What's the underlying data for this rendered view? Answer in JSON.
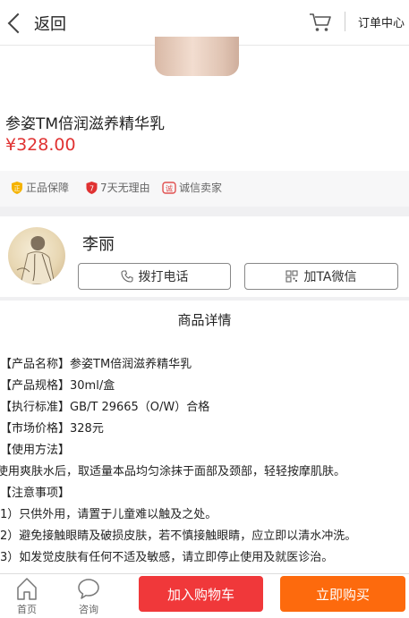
{
  "header": {
    "back_label": "返回",
    "orders_label": "订单中心"
  },
  "product": {
    "name": "参姿TM倍润滋养精华乳",
    "price": "¥328.00"
  },
  "badges": [
    {
      "icon": "shield-icon",
      "label": "正品保障",
      "color": "#f5b300"
    },
    {
      "icon": "seven-days-icon",
      "label": "7天无理由",
      "color": "#e03232"
    },
    {
      "icon": "credit-seal-icon",
      "label": "诚信卖家",
      "color": "#e05050"
    }
  ],
  "seller": {
    "name": "李丽",
    "call_label": "拨打电话",
    "wechat_label": "加TA微信"
  },
  "details": {
    "title": "商品详情",
    "lines": [
      "【产品名称】参姿TM倍润滋养精华乳",
      "【产品规格】30ml/盒",
      "【执行标准】GB/T 29665（O/W）合格",
      "【市场价格】328元",
      "【使用方法】",
      "使用爽肤水后，取适量本品均匀涂抹于面部及颈部，轻轻按摩肌肤。",
      "【注意事项】",
      "1）只供外用，请置于儿童难以触及之处。",
      "2）避免接触眼睛及破损皮肤，若不慎接触眼睛，应立即以清水冲洗。",
      "3）如发觉皮肤有任何不适及敏感，请立即停止使用及就医诊治。"
    ]
  },
  "bottom": {
    "home_label": "首页",
    "consult_label": "咨询",
    "add_cart_label": "加入购物车",
    "buy_now_label": "立即购买"
  },
  "colors": {
    "price_red": "#e03232",
    "add_cart_bg": "#f0383a",
    "buy_now_bg": "#fd6a0d"
  }
}
